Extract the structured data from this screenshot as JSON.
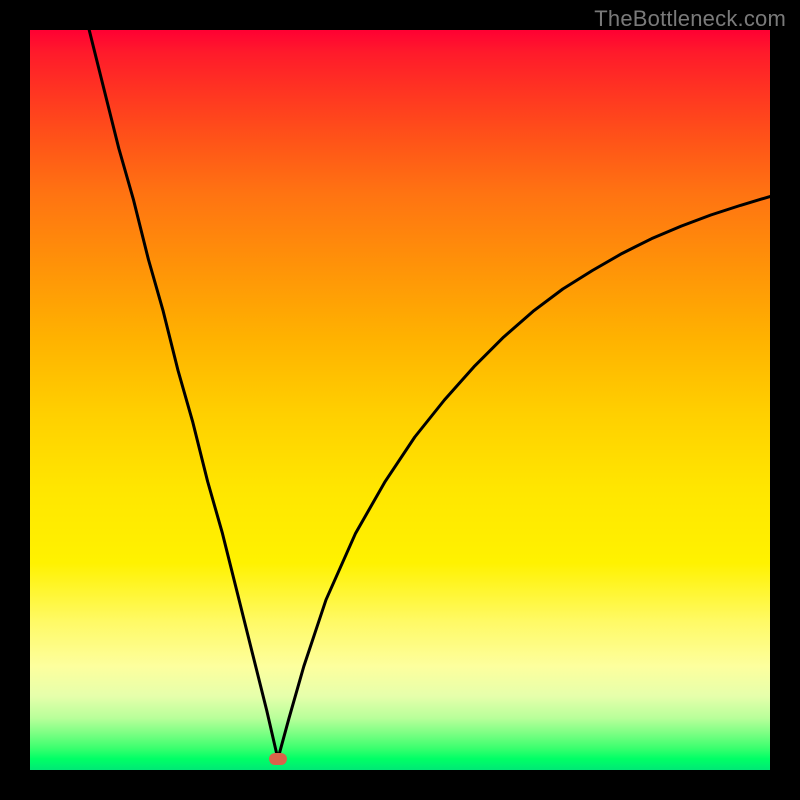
{
  "watermark": "TheBottleneck.com",
  "colors": {
    "frame_bg": "#000000",
    "curve_stroke": "#000000",
    "marker_fill": "#d9634a"
  },
  "chart_data": {
    "type": "line",
    "title": "",
    "xlabel": "",
    "ylabel": "",
    "xlim": [
      0,
      100
    ],
    "ylim": [
      0,
      100
    ],
    "grid": false,
    "legend": false,
    "annotations": {
      "marker": {
        "x": 33.5,
        "y": 1.5
      }
    },
    "description": "Asymmetric V-shaped bottleneck curve on red-to-green vertical gradient. Minimum near x≈33.5. Left branch is steep and nearly linear from top-left to the minimum; right branch rises concavely toward the upper-right, ending near y≈78 at x=100.",
    "series": [
      {
        "name": "bottleneck-curve",
        "x": [
          8,
          10,
          12,
          14,
          16,
          18,
          20,
          22,
          24,
          26,
          28,
          30,
          32,
          33.5,
          35,
          37,
          40,
          44,
          48,
          52,
          56,
          60,
          64,
          68,
          72,
          76,
          80,
          84,
          88,
          92,
          96,
          100
        ],
        "y": [
          100,
          92,
          84,
          77,
          69,
          62,
          54,
          47,
          39,
          32,
          24,
          16,
          8,
          1.5,
          7,
          14,
          23,
          32,
          39,
          45,
          50,
          54.5,
          58.5,
          62,
          65,
          67.5,
          69.8,
          71.8,
          73.5,
          75,
          76.3,
          77.5
        ]
      }
    ]
  }
}
